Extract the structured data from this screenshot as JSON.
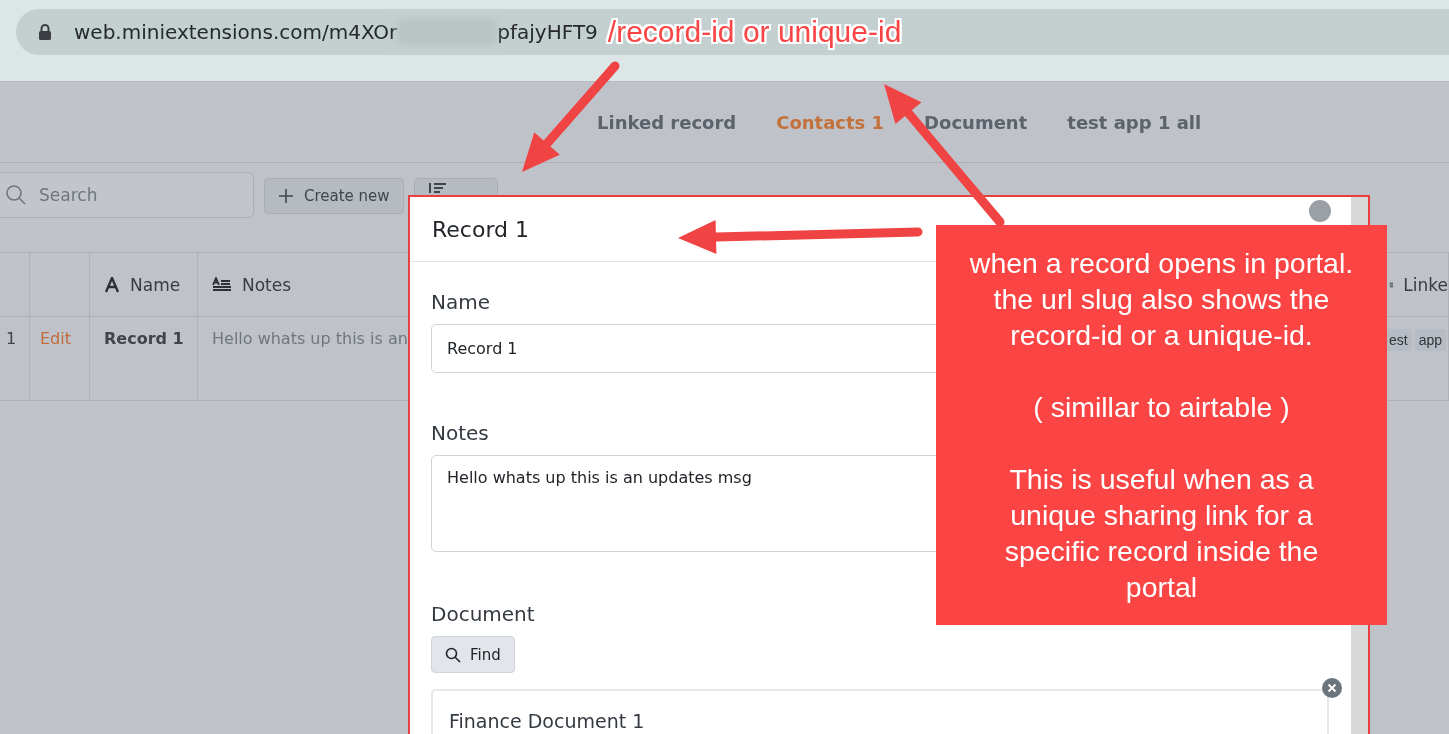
{
  "address_bar": {
    "url_start": "web.miniextensions.com/m4XOr",
    "url_end": "pfajyHFT9"
  },
  "nav_tabs": [
    {
      "label": "Linked record",
      "selected": false
    },
    {
      "label": "Contacts 1",
      "selected": true
    },
    {
      "label": "Document",
      "selected": false
    },
    {
      "label": "test app 1 all",
      "selected": false
    }
  ],
  "toolbar": {
    "search": {
      "placeholder": "Search"
    },
    "buttons": [
      {
        "kind": "create",
        "label": "Create new"
      },
      {
        "kind": "sort"
      }
    ]
  },
  "table": {
    "columns": [
      {
        "kind": "index"
      },
      {
        "kind": "action"
      },
      {
        "kind": "text",
        "label": "Name"
      },
      {
        "kind": "long_text",
        "label": "Notes"
      },
      {
        "kind": "linked",
        "label": "Linke"
      }
    ],
    "rows": [
      {
        "index": "1",
        "action": "Edit",
        "name": "Record 1",
        "notes": "Hello whats up this is an",
        "linked": [
          "est",
          "app"
        ]
      }
    ]
  },
  "modal": {
    "title": "Record 1",
    "fields": [
      {
        "kind": "text",
        "label": "Name",
        "value": "Record 1"
      },
      {
        "kind": "textarea",
        "label": "Notes",
        "value": "Hello whats up this is an updates msg"
      },
      {
        "kind": "link",
        "label": "Document",
        "button": "Find",
        "records": [
          "Finance Document 1"
        ]
      }
    ]
  },
  "annotations": {
    "url_label": "/record-id or unique-id",
    "callout": "when a record opens in portal.\nthe url slug also shows the\nrecord-id or a unique-id.\n\n( simillar to airtable )\n\nThis is useful when as a\nunique sharing link for a\nspecific record inside the\nportal"
  }
}
